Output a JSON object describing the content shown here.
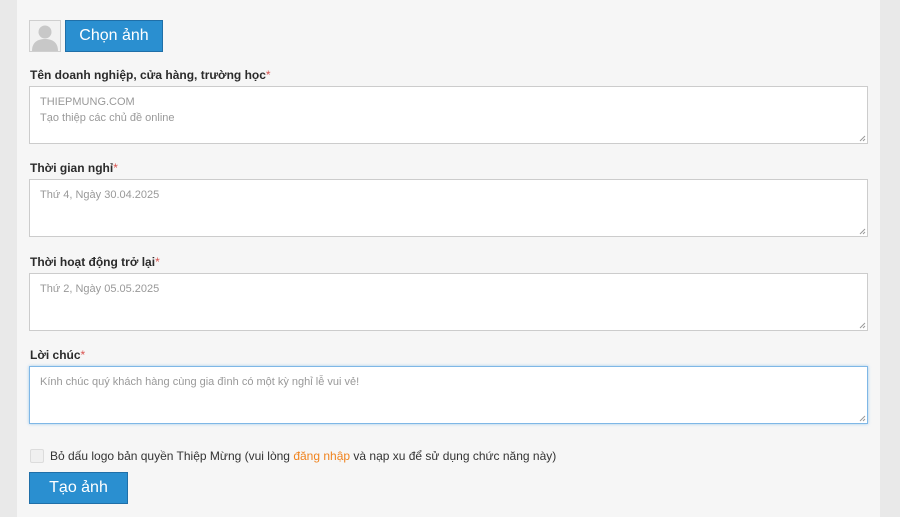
{
  "upload": {
    "choose_label": "Chọn ảnh"
  },
  "fields": [
    {
      "label": "Tên doanh nghiệp, cửa hàng, trường học",
      "required_mark": "*",
      "line1": "THIEPMUNG.COM",
      "line2": "Tạo thiệp các chủ đề online"
    },
    {
      "label": "Thời gian nghỉ",
      "required_mark": "*",
      "line1": "Thứ 4, Ngày 30.04.2025"
    },
    {
      "label": "Thời hoạt động trở lại",
      "required_mark": "*",
      "line1": "Thứ 2, Ngày 05.05.2025"
    },
    {
      "label": "Lời chúc",
      "required_mark": "*",
      "line1": "Kính chúc quý khách hàng cùng gia đình có một kỳ nghỉ lễ vui vẻ!"
    }
  ],
  "watermark_option": {
    "text_before": "Bỏ dấu logo bản quyền Thiệp Mừng (vui lòng ",
    "link_text": "đăng nhập",
    "text_after": " và nạp xu để sử dụng chức năng này)",
    "checked": false
  },
  "actions": {
    "create_label": "Tạo ảnh"
  },
  "colors": {
    "primary": "#2a8fd0",
    "link": "#f0831e",
    "required": "#d9534f"
  }
}
